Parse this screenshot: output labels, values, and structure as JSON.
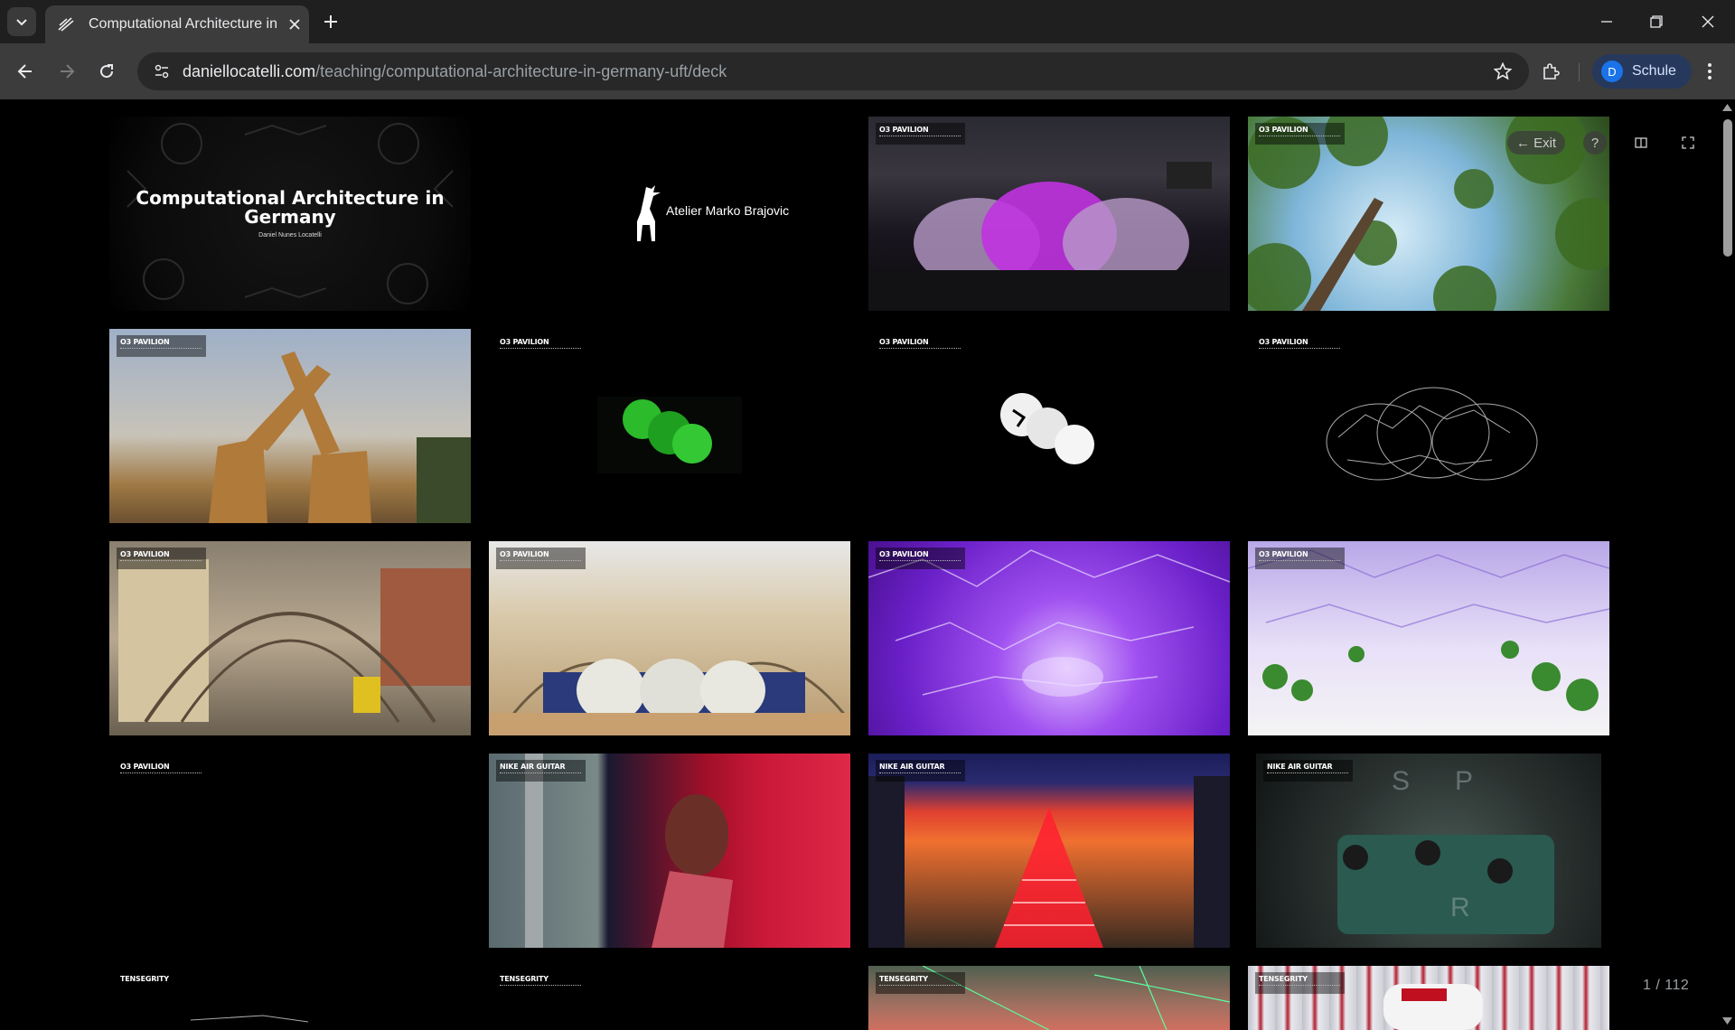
{
  "browser": {
    "tab_title": "Computational Architecture in Germany",
    "url_host": "daniellocatelli.com",
    "url_path": "/teaching/computational-architecture-in-germany-uft/deck",
    "profile_initial": "D",
    "profile_name": "Schule"
  },
  "deck": {
    "exit_label": "← Exit",
    "help_label": "?",
    "counter": "1 / 112"
  },
  "slides": [
    {
      "title": "Computational Architecture in Germany",
      "author": "Daniel Nunes Locatelli"
    },
    {
      "logo_text": "Atelier Marko Brajovic"
    },
    {
      "label": "O3 PAVILION"
    },
    {
      "label": "O3 PAVILION"
    },
    {
      "label": "O3 PAVILION"
    },
    {
      "label": "O3 PAVILION"
    },
    {
      "label": "O3 PAVILION"
    },
    {
      "label": "O3 PAVILION"
    },
    {
      "label": "O3 PAVILION"
    },
    {
      "label": "O3 PAVILION"
    },
    {
      "label": "O3 PAVILION"
    },
    {
      "label": "O3 PAVILION"
    },
    {
      "label": "O3 PAVILION"
    },
    {
      "label": "NIKE AIR GUITAR"
    },
    {
      "label": "NIKE AIR GUITAR"
    },
    {
      "label": "NIKE AIR GUITAR"
    },
    {
      "label": "TENSEGRITY"
    },
    {
      "label": "TENSEGRITY"
    },
    {
      "label": "TENSEGRITY"
    },
    {
      "label": "TENSEGRITY"
    }
  ]
}
